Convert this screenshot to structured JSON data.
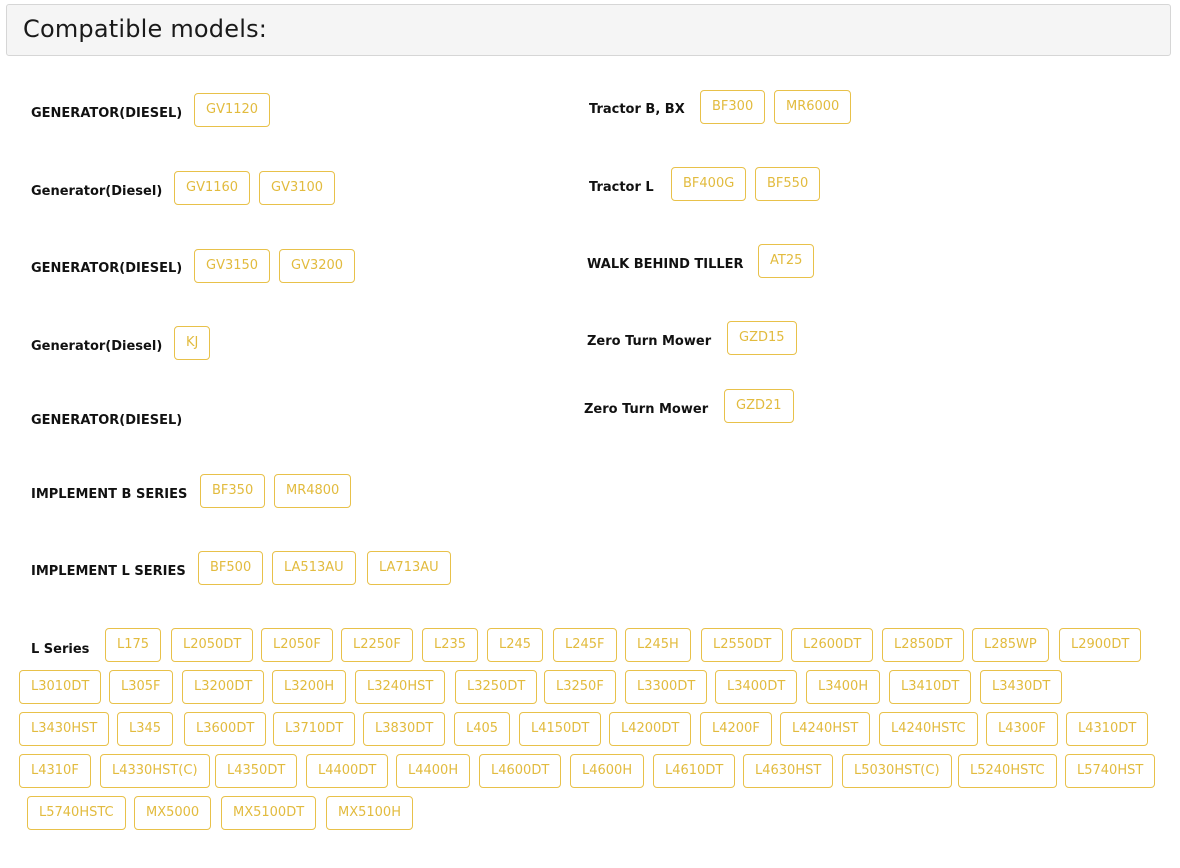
{
  "header": {
    "title": "Compatible models:"
  },
  "left_rows": [
    {
      "label": "GENERATOR(DIESEL)",
      "models": [
        "GV1120"
      ]
    },
    {
      "label": "Generator(Diesel)",
      "models": [
        "GV1160",
        "GV3100"
      ]
    },
    {
      "label": "GENERATOR(DIESEL)",
      "models": [
        "GV3150",
        "GV3200"
      ]
    },
    {
      "label": "Generator(Diesel)",
      "models": [
        "KJ"
      ]
    },
    {
      "label": "GENERATOR(DIESEL)",
      "models": []
    },
    {
      "label": "IMPLEMENT B SERIES",
      "models": [
        "BF350",
        "MR4800"
      ]
    },
    {
      "label": "IMPLEMENT L SERIES",
      "models": [
        "BF500",
        "LA513AU",
        "LA713AU"
      ]
    }
  ],
  "right_rows": [
    {
      "label": "Tractor B, BX",
      "models": [
        "BF300",
        "MR6000"
      ]
    },
    {
      "label": "Tractor L",
      "models": [
        "BF400G",
        "BF550"
      ]
    },
    {
      "label": "WALK BEHIND TILLER",
      "models": [
        "AT25"
      ]
    },
    {
      "label": "Zero Turn Mower",
      "models": [
        "GZD15"
      ]
    },
    {
      "label": "Zero Turn Mower",
      "models": [
        "GZD21"
      ]
    }
  ],
  "l_series": {
    "label": "L Series",
    "models": [
      "L175",
      "L2050DT",
      "L2050F",
      "L2250F",
      "L235",
      "L245",
      "L245F",
      "L245H",
      "L2550DT",
      "L2600DT",
      "L2850DT",
      "L285WP",
      "L2900DT",
      "L3010DT",
      "L305F",
      "L3200DT",
      "L3200H",
      "L3240HST",
      "L3250DT",
      "L3250F",
      "L3300DT",
      "L3400DT",
      "L3400H",
      "L3410DT",
      "L3430DT",
      "L3430HST",
      "L345",
      "L3600DT",
      "L3710DT",
      "L3830DT",
      "L405",
      "L4150DT",
      "L4200DT",
      "L4200F",
      "L4240HST",
      "L4240HSTC",
      "L4300F",
      "L4310DT",
      "L4310F",
      "L4330HST(C)",
      "L4350DT",
      "L4400DT",
      "L4400H",
      "L4600DT",
      "L4600H",
      "L4610DT",
      "L4630HST",
      "L5030HST(C)",
      "L5240HSTC",
      "L5740HST",
      "L5740HSTC",
      "MX5000",
      "MX5100DT",
      "MX5100H"
    ]
  },
  "colors": {
    "tag_border": "#e8c14a",
    "tag_text": "#e2bb3e",
    "header_bg": "#f5f5f5"
  }
}
